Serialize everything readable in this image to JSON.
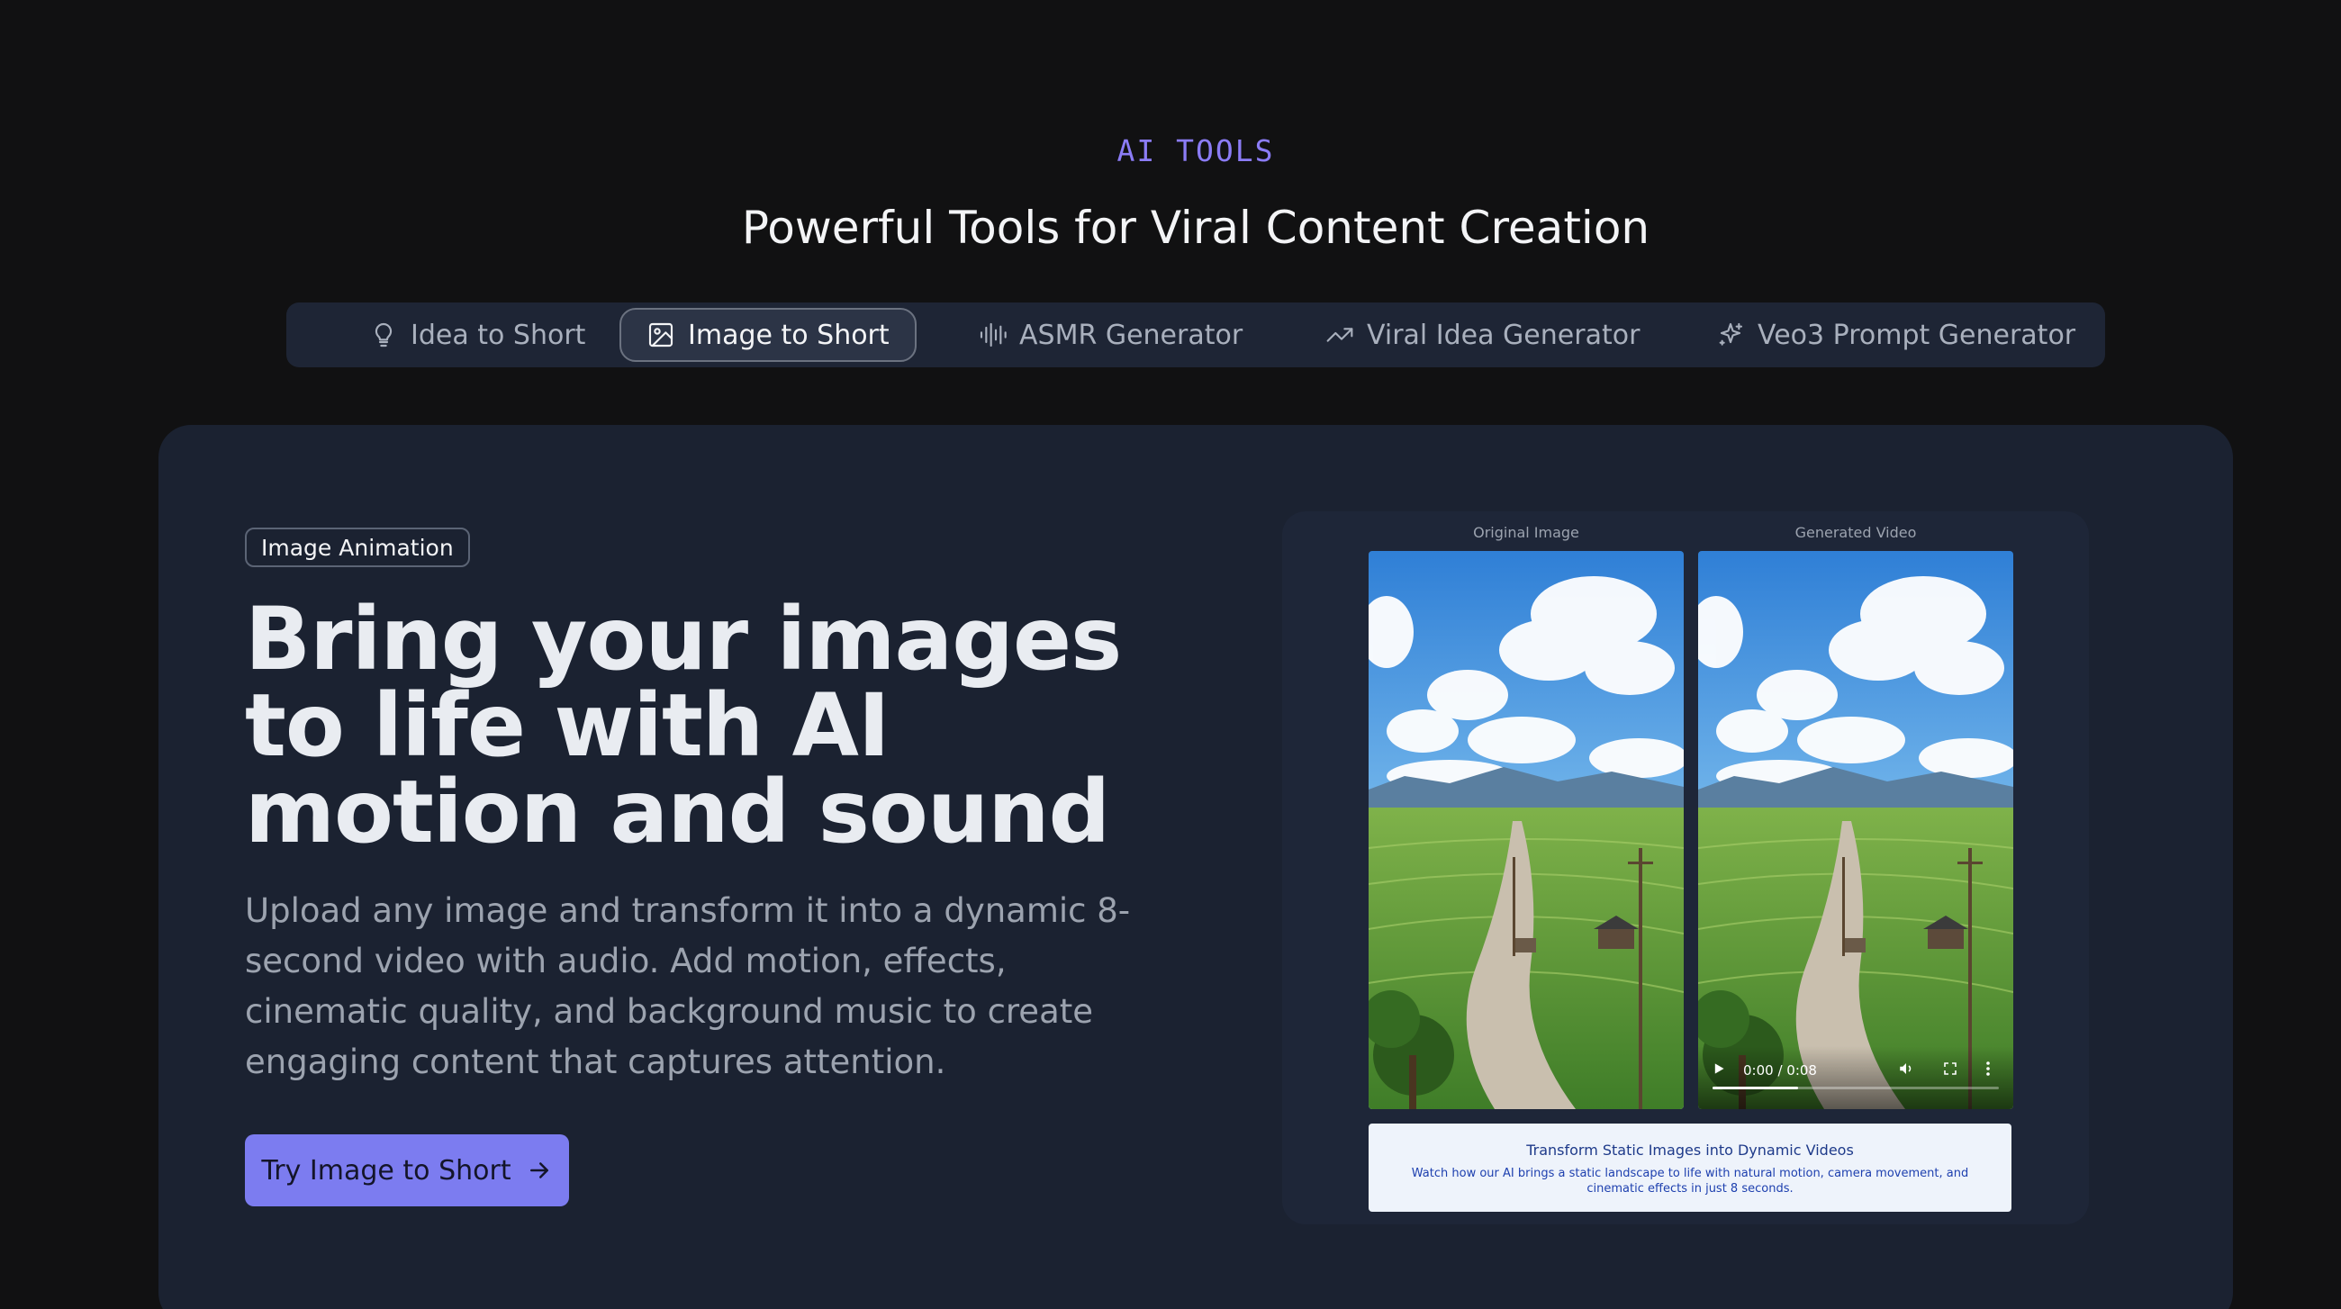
{
  "section": {
    "eyebrow": "AI TOOLS",
    "title": "Powerful Tools for Viral Content Creation"
  },
  "tabs": [
    {
      "label": "Idea to Short",
      "icon": "lightbulb-icon",
      "active": false
    },
    {
      "label": "Image to Short",
      "icon": "image-icon",
      "active": true
    },
    {
      "label": "ASMR Generator",
      "icon": "audio-wave-icon",
      "active": false
    },
    {
      "label": "Viral Idea Generator",
      "icon": "trending-up-icon",
      "active": false
    },
    {
      "label": "Veo3 Prompt Generator",
      "icon": "sparkles-icon",
      "active": false
    }
  ],
  "hero": {
    "badge": "Image Animation",
    "headline": "Bring your images to life with AI motion and sound",
    "description": "Upload any image and transform it into a dynamic 8-second video with audio. Add motion, effects, cinematic quality, and background music to create engaging content that captures attention.",
    "cta_label": "Try Image to Short",
    "cta_icon": "arrow-right-icon"
  },
  "showcase": {
    "original_label": "Original Image",
    "generated_label": "Generated Video",
    "video": {
      "time": "0:00 / 0:08",
      "progress": 0.3
    },
    "caption_title": "Transform Static Images into Dynamic Videos",
    "caption_body": "Watch how our AI brings a static landscape to life with natural motion, camera movement, and cinematic effects in just 8 seconds."
  },
  "colors": {
    "accent": "#8b7cf6",
    "cta": "#7c7cf0",
    "card": "#1b2231",
    "background": "#111112"
  }
}
